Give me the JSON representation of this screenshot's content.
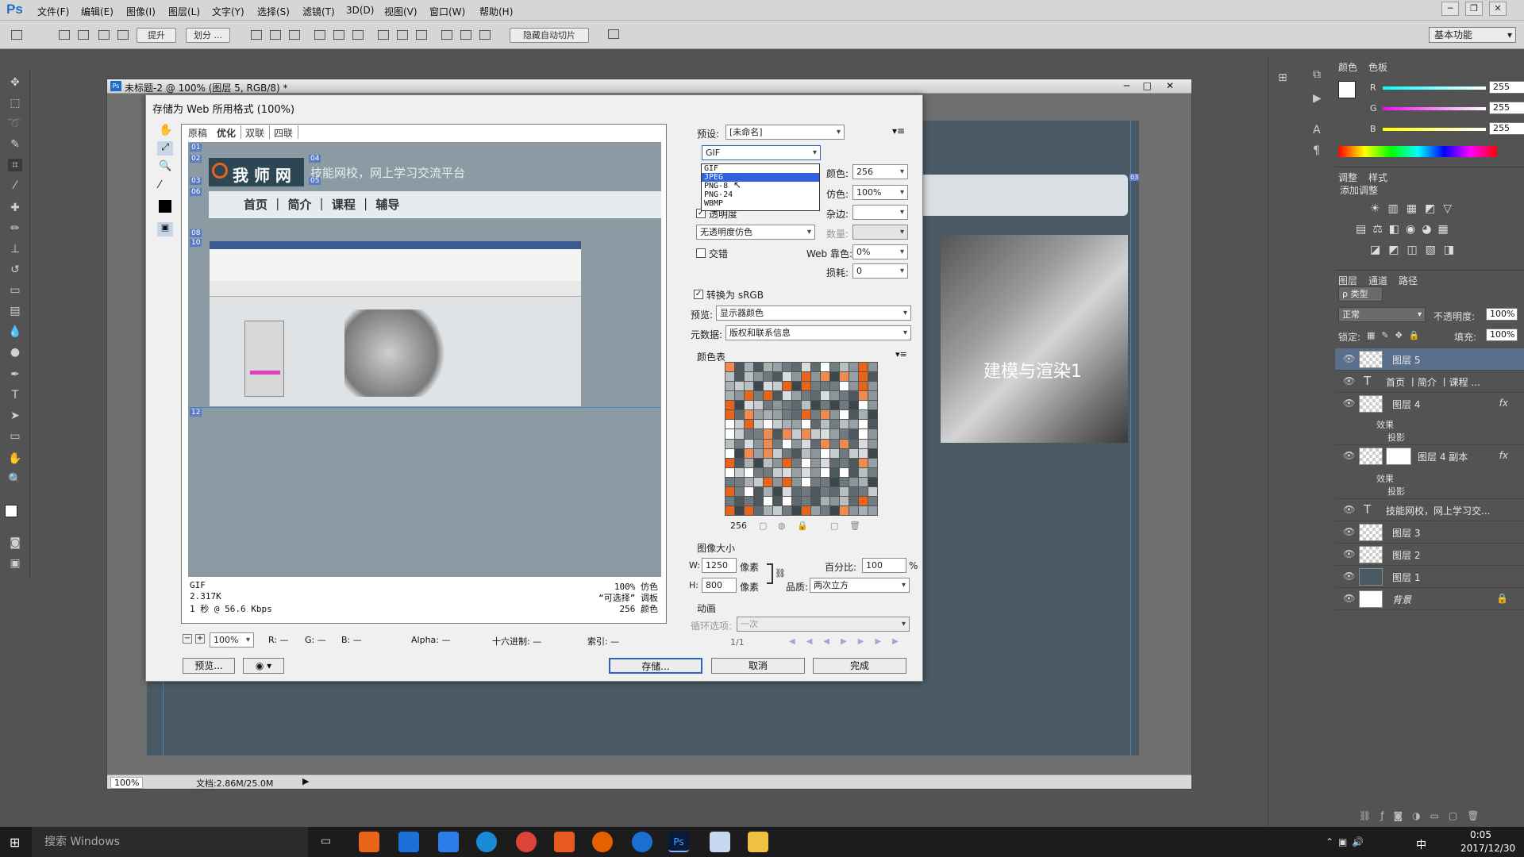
{
  "app": {
    "logo": "Ps"
  },
  "menu": [
    "文件(F)",
    "编辑(E)",
    "图像(I)",
    "图层(L)",
    "文字(Y)",
    "选择(S)",
    "滤镜(T)",
    "3D(D)",
    "视图(V)",
    "窗口(W)",
    "帮助(H)"
  ],
  "options": {
    "promote": "提升",
    "divide": "划分 ...",
    "hide_auto_slices": "隐藏自动切片",
    "workspace": "基本功能"
  },
  "document": {
    "title": "未标题-2 @ 100% (图层 5, RGB/8) *",
    "zoom": "100%",
    "doc_size": "文档:2.86M/25.0M",
    "canvas_text": "建模与渲染1",
    "slice_mark": "03"
  },
  "dialog": {
    "title": "存储为 Web 所用格式 (100%)",
    "tabs": [
      "原稿",
      "优化",
      "双联",
      "四联"
    ],
    "preview": {
      "logo_text": "我 师 网",
      "tagline": "技能网校，网上学习交流平台",
      "nav": "首页 ｜ 简介 ｜ 课程 ｜ 辅导",
      "slices": [
        "01",
        "02",
        "03",
        "04",
        "05",
        "06",
        "08",
        "10",
        "12"
      ],
      "footer_left": [
        "GIF",
        "2.317K",
        "1 秒 @ 56.6 Kbps"
      ],
      "footer_right": [
        "100% 仿色",
        "“可选择” 调板",
        "256 颜色"
      ]
    },
    "bottom": {
      "zoom": "100%",
      "r": "R: —",
      "g": "G: —",
      "b": "B: —",
      "alpha": "Alpha: —",
      "hex": "十六进制: —",
      "index": "索引: —",
      "preview_btn": "预览...",
      "save": "存储...",
      "cancel": "取消",
      "done": "完成"
    },
    "settings": {
      "preset_label": "预设:",
      "preset_value": "[未命名]",
      "format": "GIF",
      "format_options": [
        "GIF",
        "JPEG",
        "PNG-8",
        "PNG-24",
        "WBMP"
      ],
      "colors_label": "颜色:",
      "colors_value": "256",
      "dither_label": "仿色:",
      "dither_value": "100%",
      "transparency": "透明度",
      "matte_label": "杂边:",
      "trans_dither": "无透明度仿色",
      "amount_label": "数量:",
      "interlace": "交错",
      "web_snap_label": "Web 靠色:",
      "web_snap_value": "0%",
      "lossy_label": "损耗:",
      "lossy_value": "0",
      "convert_srgb": "转换为 sRGB",
      "preview_label": "预览:",
      "preview_value": "显示器颜色",
      "metadata_label": "元数据:",
      "metadata_value": "版权和联系信息",
      "color_table_label": "颜色表",
      "color_count": "256",
      "image_size_label": "图像大小",
      "w_label": "W:",
      "w_value": "1250",
      "h_label": "H:",
      "h_value": "800",
      "px": "像素",
      "percent_label": "百分比:",
      "percent_value": "100",
      "percent_sign": "%",
      "quality_label": "品质:",
      "quality_value": "两次立方",
      "animation_label": "动画",
      "loop_label": "循环选项:",
      "loop_value": "一次",
      "frame": "1/1"
    }
  },
  "color_panel": {
    "tabs": [
      "颜色",
      "色板"
    ],
    "r": "255",
    "g": "255",
    "b": "255",
    "r_lbl": "R",
    "g_lbl": "G",
    "b_lbl": "B"
  },
  "adjust_panel": {
    "tabs": [
      "调整",
      "样式"
    ],
    "add": "添加调整"
  },
  "layers_panel": {
    "tabs": [
      "图层",
      "通道",
      "路径"
    ],
    "kind": "ρ 类型",
    "blend": "正常",
    "opacity_label": "不透明度:",
    "opacity": "100%",
    "lock_label": "锁定:",
    "fill_label": "填充:",
    "fill": "100%",
    "layers": [
      {
        "name": "图层 5",
        "fx": ""
      },
      {
        "name": "首页 丨简介 丨课程 ...",
        "fx": "",
        "type": "T"
      },
      {
        "name": "图层 4",
        "fx": "fx"
      },
      {
        "name": "图层 4 副本",
        "fx": "fx"
      },
      {
        "name": "技能网校，网上学习交...",
        "fx": "",
        "type": "T"
      },
      {
        "name": "图层 3",
        "fx": ""
      },
      {
        "name": "图层 2",
        "fx": ""
      },
      {
        "name": "图层 1",
        "fx": ""
      },
      {
        "name": "背景",
        "fx": ""
      }
    ],
    "effect": "效果",
    "shadow": "投影"
  },
  "taskbar": {
    "search": "搜索 Windows",
    "time": "0:05",
    "date": "2017/12/30",
    "ime": "中"
  },
  "colors": {
    "ps_blue": "#1c6fc8",
    "orange": "#e8641a",
    "highlight": "#3060e0"
  }
}
